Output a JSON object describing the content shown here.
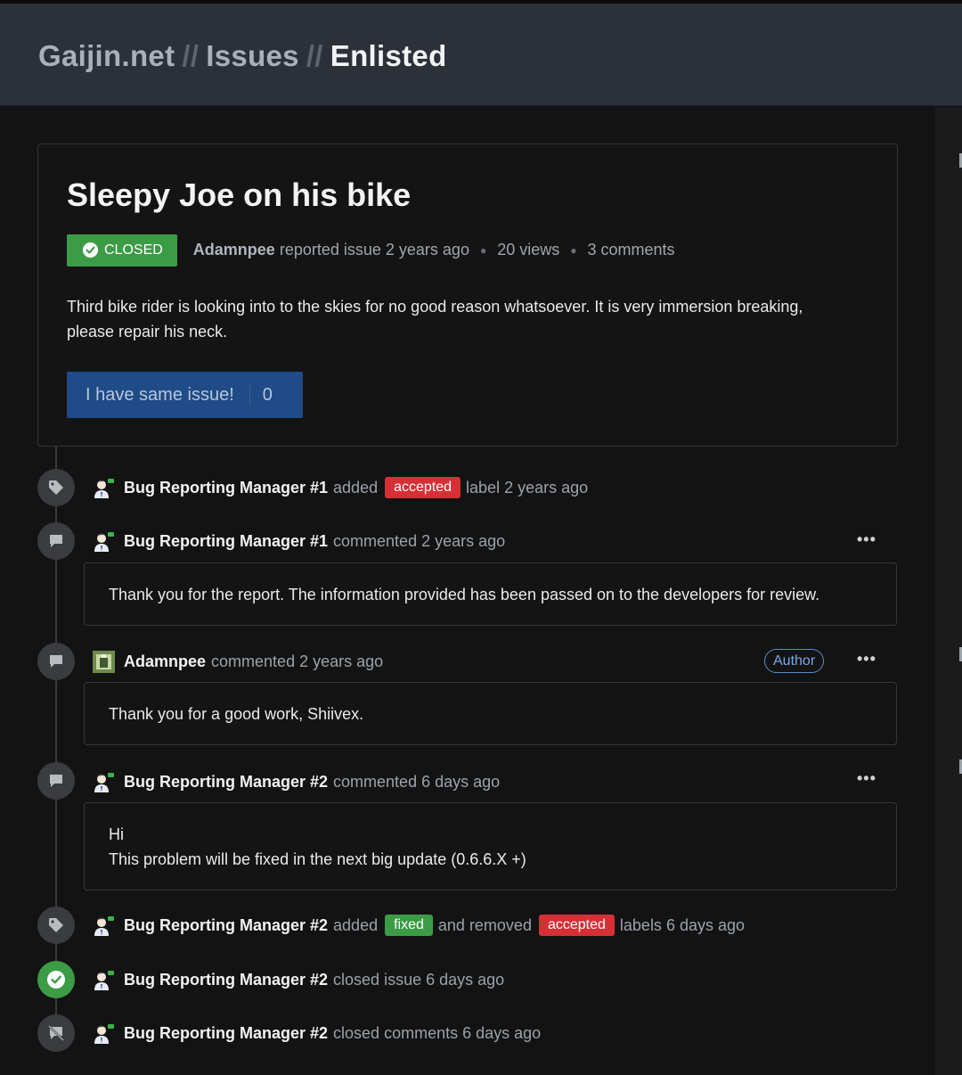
{
  "header": {
    "crumbs": [
      "Gaijin.net",
      "Issues",
      "Enlisted"
    ],
    "separator": "//"
  },
  "issue": {
    "title": "Sleepy Joe on his bike",
    "status": "CLOSED",
    "author": "Adamnpee",
    "reported_text": "reported issue 2 years ago",
    "views": "20 views",
    "comments": "3 comments",
    "body": "Third bike rider is looking into to the skies for no good reason whatsoever. It is very immersion breaking, please repair his neck.",
    "same_issue_label": "I have same issue!",
    "same_issue_count": "0"
  },
  "timeline": {
    "e1": {
      "user": "Bug Reporting Manager #1",
      "action": "added",
      "label": "accepted",
      "suffix": "label 2 years ago",
      "icon": "tag-icon"
    },
    "c1": {
      "user": "Bug Reporting Manager #1",
      "action": "commented 2 years ago",
      "body": "Thank you for the report. The information provided has been passed on to the developers for review.",
      "icon": "comment-icon"
    },
    "c2": {
      "user": "Adamnpee",
      "action": "commented 2 years ago",
      "badge": "Author",
      "body": "Thank you for a good work, Shiivex.",
      "icon": "comment-icon"
    },
    "c3": {
      "user": "Bug Reporting Manager #2",
      "action": "commented 6 days ago",
      "body_line1": "Hi",
      "body_line2": "This problem will be fixed in the next big update (0.6.6.X +)",
      "icon": "comment-icon"
    },
    "e2": {
      "user": "Bug Reporting Manager #2",
      "action": "added",
      "label1": "fixed",
      "middle": "and removed",
      "label2": "accepted",
      "suffix": "labels 6 days ago",
      "icon": "tag-icon"
    },
    "e3": {
      "user": "Bug Reporting Manager #2",
      "action": "closed issue 6 days ago",
      "icon": "check-circle-icon"
    },
    "e4": {
      "user": "Bug Reporting Manager #2",
      "action": "closed comments 6 days ago",
      "icon": "comment-off-icon"
    },
    "more_menu": "•••"
  },
  "colors": {
    "green": "#3c9c46",
    "red": "#d62f35",
    "button_blue": "#1f4b86",
    "author_blue": "#7fa8e6"
  }
}
